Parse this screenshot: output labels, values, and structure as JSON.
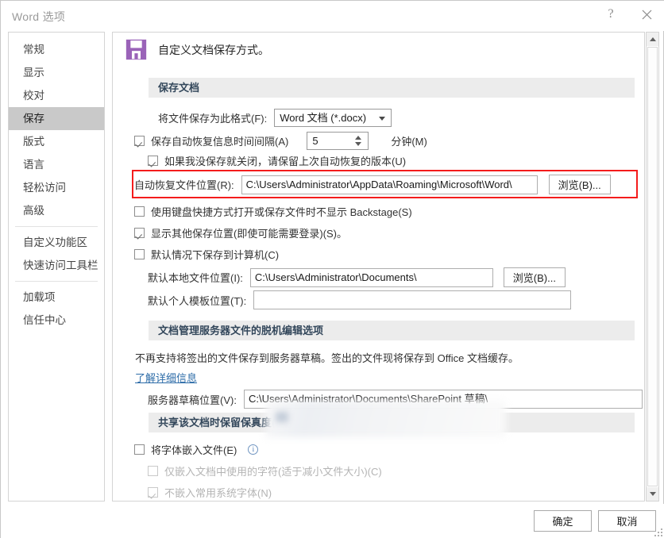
{
  "window": {
    "title": "Word 选项",
    "help_icon": "question-mark-icon",
    "close_icon": "close-icon"
  },
  "sidebar": {
    "items": [
      {
        "label": "常规",
        "selected": false
      },
      {
        "label": "显示",
        "selected": false
      },
      {
        "label": "校对",
        "selected": false
      },
      {
        "label": "保存",
        "selected": true
      },
      {
        "label": "版式",
        "selected": false
      },
      {
        "label": "语言",
        "selected": false
      },
      {
        "label": "轻松访问",
        "selected": false
      },
      {
        "label": "高级",
        "selected": false
      },
      {
        "label": "自定义功能区",
        "selected": false
      },
      {
        "label": "快速访问工具栏",
        "selected": false
      },
      {
        "label": "加载项",
        "selected": false
      },
      {
        "label": "信任中心",
        "selected": false
      }
    ]
  },
  "page": {
    "icon": "floppy-disk-save-icon",
    "heading": "自定义文档保存方式。"
  },
  "sections": {
    "save_documents": "保存文档",
    "offline_editing": "文档管理服务器文件的脱机编辑选项",
    "preserve_fidelity": "共享该文档时保留保真度(D):"
  },
  "save_documents": {
    "format_label": "将文件保存为此格式(F):",
    "format_value": "Word 文档 (*.docx)",
    "autorecover_label": "保存自动恢复信息时间间隔(A)",
    "autorecover_checked": true,
    "autorecover_minutes": "5",
    "minutes_label": "分钟(M)",
    "keep_last_label": "如果我没保存就关闭，请保留上次自动恢复的版本(U)",
    "keep_last_checked": true,
    "autorecover_path_label": "自动恢复文件位置(R):",
    "autorecover_path_value": "C:\\Users\\Administrator\\AppData\\Roaming\\Microsoft\\Word\\",
    "browse_label": "浏览(B)...",
    "no_backstage_label": "使用键盘快捷方式打开或保存文件时不显示 Backstage(S)",
    "no_backstage_checked": false,
    "show_other_label": "显示其他保存位置(即使可能需要登录)(S)。",
    "show_other_checked": true,
    "save_to_computer_label": "默认情况下保存到计算机(C)",
    "save_to_computer_checked": false,
    "local_path_label": "默认本地文件位置(I):",
    "local_path_value": "C:\\Users\\Administrator\\Documents\\",
    "local_browse_label": "浏览(B)...",
    "template_path_label": "默认个人模板位置(T):",
    "template_path_value": ""
  },
  "offline_editing": {
    "description": "不再支持将签出的文件保存到服务器草稿。签出的文件现将保存到 Office 文档缓存。",
    "learn_more": "了解详细信息",
    "server_draft_label": "服务器草稿位置(V):",
    "server_draft_value": "C:\\Users\\Administrator\\Documents\\SharePoint 草稿\\"
  },
  "preserve_fidelity": {
    "embed_fonts_label": "将字体嵌入文件(E)",
    "embed_fonts_checked": false,
    "embed_fonts_info_icon": "info-circle-icon",
    "embed_used_only_label": "仅嵌入文档中使用的字符(适于减小文件大小)(C)",
    "embed_used_only_checked": false,
    "embed_used_only_disabled": true,
    "no_common_fonts_label": "不嵌入常用系统字体(N)",
    "no_common_fonts_checked": true,
    "no_common_fonts_disabled": true
  },
  "footer": {
    "ok_label": "确定",
    "cancel_label": "取消"
  },
  "annotation": {
    "type": "red-highlight-box",
    "target": "自动恢复文件位置(R):",
    "color": "#f41c1c"
  },
  "colors": {
    "accent_purple": "#9a63b8",
    "section_header_bg": "#ececec",
    "section_header_text": "#33475b",
    "selected_sidebar_bg": "#c9c9c9",
    "link_blue": "#2d6ca8"
  },
  "scrollbar": {
    "up_icon": "triangle-up-icon",
    "down_icon": "triangle-down-icon"
  }
}
